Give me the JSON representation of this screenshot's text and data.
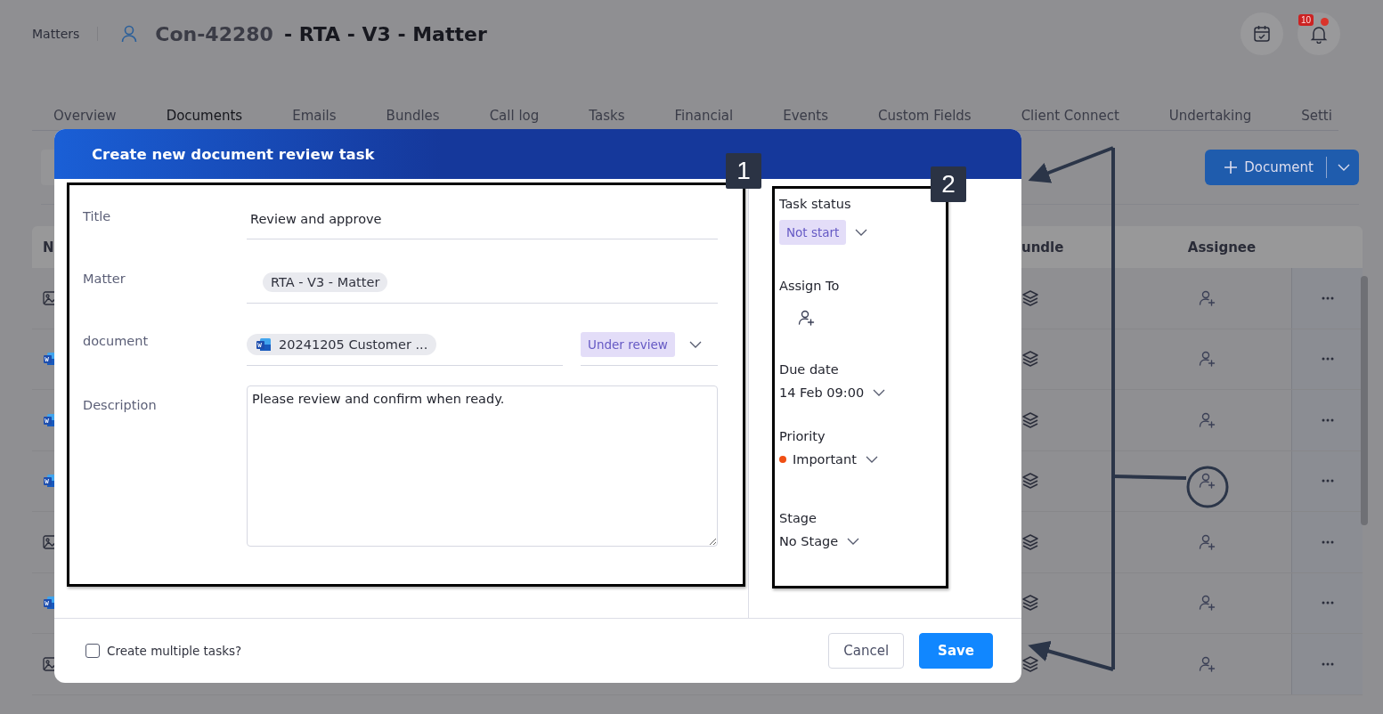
{
  "header": {
    "breadcrumb": "Matters",
    "matter_id": "Con-42280",
    "matter_name": "- RTA - V3 - Matter",
    "notification_count": "10"
  },
  "tabs": [
    {
      "label": "Overview",
      "selected": false
    },
    {
      "label": "Documents",
      "selected": true
    },
    {
      "label": "Emails",
      "selected": false
    },
    {
      "label": "Bundles",
      "selected": false
    },
    {
      "label": "Call log",
      "selected": false
    },
    {
      "label": "Tasks",
      "selected": false
    },
    {
      "label": "Financial",
      "selected": false
    },
    {
      "label": "Events",
      "selected": false
    },
    {
      "label": "Custom Fields",
      "selected": false
    },
    {
      "label": "Client Connect",
      "selected": false
    },
    {
      "label": "Undertaking",
      "selected": false
    },
    {
      "label": "Setti",
      "selected": false
    }
  ],
  "toolbar": {
    "add_button": "Document"
  },
  "table": {
    "columns": [
      "N",
      "undle",
      "Assignee"
    ],
    "rows": [
      {
        "kind": "image"
      },
      {
        "kind": "word"
      },
      {
        "kind": "word"
      },
      {
        "kind": "word"
      },
      {
        "kind": "image"
      },
      {
        "kind": "word"
      },
      {
        "kind": "image"
      }
    ]
  },
  "dialog": {
    "title": "Create new document review task",
    "fields": [
      {
        "label": "Title",
        "kind": "text",
        "value": "Review and approve"
      },
      {
        "label": "Matter",
        "kind": "chip",
        "value": "RTA - V3 - Matter"
      },
      {
        "label": "document",
        "kind": "document",
        "value": "20241205 Customer ...",
        "status": "Under review"
      },
      {
        "label": "Description",
        "kind": "textarea",
        "value": "Please review and confirm when ready."
      }
    ],
    "side": [
      {
        "label": "Task status",
        "kind": "status",
        "value": "Not start"
      },
      {
        "label": "Assign To",
        "kind": "assignee"
      },
      {
        "label": "Due date",
        "kind": "select",
        "value": "14 Feb 09:00"
      },
      {
        "label": "Priority",
        "kind": "priority",
        "value": "Important",
        "color": "#f04f14"
      },
      {
        "label": "Stage",
        "kind": "select",
        "value": "No Stage"
      }
    ],
    "multiple_tasks": {
      "label": "Create multiple tasks?",
      "checked": false
    },
    "buttons": [
      {
        "label": "Cancel",
        "kind": "secondary"
      },
      {
        "label": "Save",
        "kind": "primary"
      }
    ]
  },
  "annotations": [
    "1",
    "2"
  ]
}
